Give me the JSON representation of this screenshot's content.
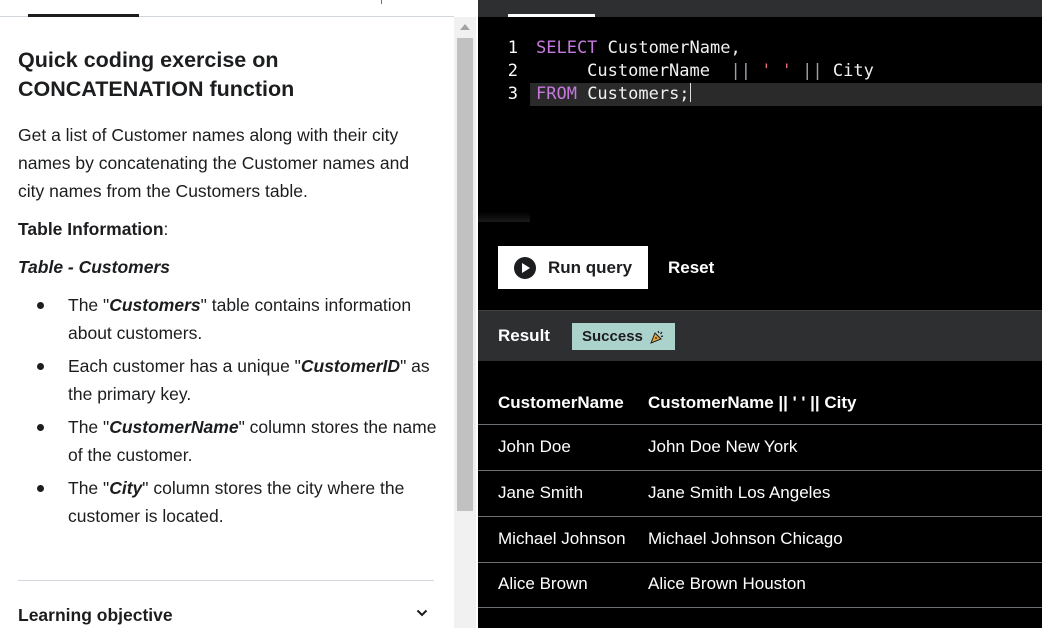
{
  "lesson": {
    "title": "Quick coding exercise on CONCATENATION function",
    "description": "Get a list of Customer names along with their city names by concatenating the Customer names and city names from the Customers table.",
    "table_info_label": "Table Information",
    "table_info_colon": ":",
    "table_name": "Table - Customers",
    "bullets": [
      {
        "pre": "The \"",
        "bold": "Customers",
        "post": "\" table contains information about customers."
      },
      {
        "pre": "Each customer has a unique \"",
        "bold": "CustomerID",
        "post": "\" as the primary key."
      },
      {
        "pre": "The \"",
        "bold": "CustomerName",
        "post": "\" column stores the name of the customer."
      },
      {
        "pre": "The \"",
        "bold": "City",
        "post": "\" column stores the city where the customer is located."
      }
    ],
    "learning_objective": "Learning objective",
    "chevron_icon": "chevron-down-icon"
  },
  "editor": {
    "line_numbers": [
      "1",
      "2",
      "3"
    ],
    "line1": {
      "kw": "SELECT",
      "rest": " CustomerName,"
    },
    "line2": {
      "indent": "     CustomerName ",
      "op1": " || ",
      "str": "' '",
      "op2": " || ",
      "rest": "City"
    },
    "line3": {
      "kw": "FROM",
      "rest": " Customers;"
    }
  },
  "actions": {
    "run_label": "Run query",
    "reset_label": "Reset",
    "play_icon": "play-circle-icon"
  },
  "result": {
    "label": "Result",
    "status": "Success",
    "status_icon": "party-popper-icon",
    "columns": [
      "CustomerName",
      "CustomerName || ' ' || City"
    ],
    "rows": [
      [
        "John Doe",
        "John Doe New York"
      ],
      [
        "Jane Smith",
        "Jane Smith Los Angeles"
      ],
      [
        "Michael Johnson",
        "Michael Johnson Chicago"
      ],
      [
        "Alice Brown",
        "Alice Brown Houston"
      ]
    ]
  },
  "colors": {
    "badge_bg": "#acd2cc",
    "keyword": "#c678dd",
    "string": "#e06c75",
    "panel_dark": "#2d2f31"
  }
}
